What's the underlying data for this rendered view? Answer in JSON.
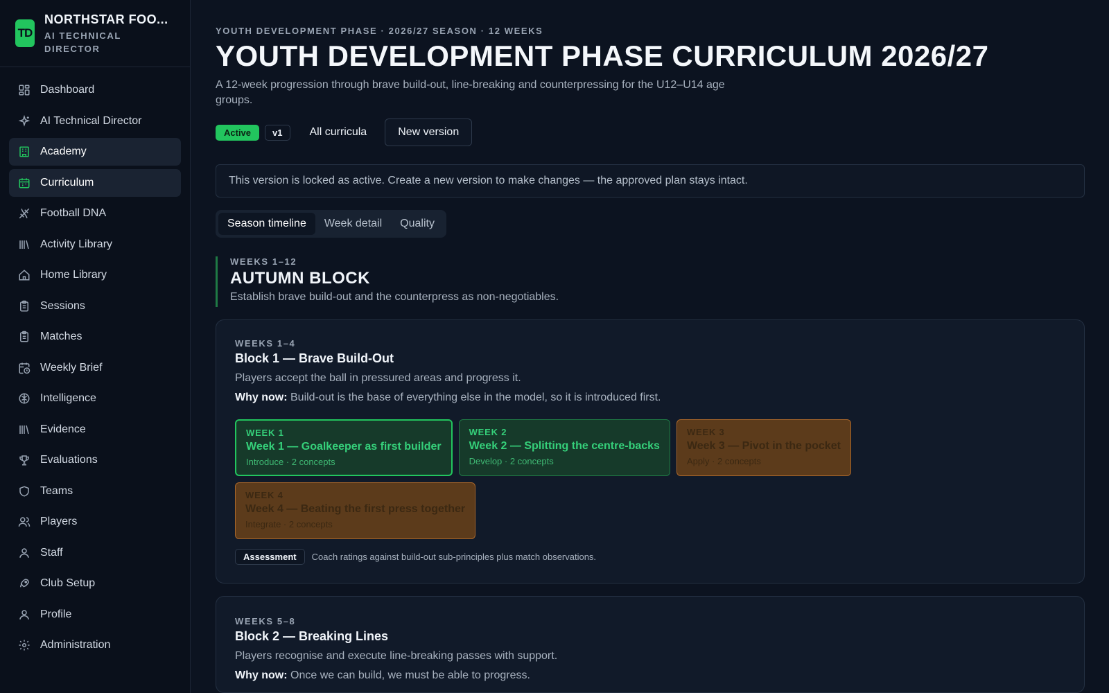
{
  "brand": {
    "logo_text": "TD",
    "name": "NORTHSTAR FOO...",
    "subtitle": "AI TECHNICAL DIRECTOR",
    "accent_color": "#22c55e"
  },
  "sidebar": {
    "items": [
      {
        "label": "Dashboard",
        "icon": "dashboard-icon"
      },
      {
        "label": "AI Technical Director",
        "icon": "sparkles-icon"
      },
      {
        "label": "Academy",
        "icon": "building-icon"
      },
      {
        "label": "Curriculum",
        "icon": "calendar-icon"
      },
      {
        "label": "Football DNA",
        "icon": "dna-icon"
      },
      {
        "label": "Activity Library",
        "icon": "library-icon"
      },
      {
        "label": "Home Library",
        "icon": "home-icon"
      },
      {
        "label": "Sessions",
        "icon": "clipboard-icon"
      },
      {
        "label": "Matches",
        "icon": "clipboard-icon"
      },
      {
        "label": "Weekly Brief",
        "icon": "calendar-clock-icon"
      },
      {
        "label": "Intelligence",
        "icon": "brain-icon"
      },
      {
        "label": "Evidence",
        "icon": "library-icon"
      },
      {
        "label": "Evaluations",
        "icon": "trophy-icon"
      },
      {
        "label": "Teams",
        "icon": "shield-icon"
      },
      {
        "label": "Players",
        "icon": "users-icon"
      },
      {
        "label": "Staff",
        "icon": "user-icon"
      },
      {
        "label": "Club Setup",
        "icon": "rocket-icon"
      },
      {
        "label": "Profile",
        "icon": "user-icon"
      },
      {
        "label": "Administration",
        "icon": "gear-icon"
      }
    ],
    "active_items": [
      "Academy",
      "Curriculum"
    ]
  },
  "header": {
    "eyebrow": "YOUTH DEVELOPMENT PHASE · 2026/27 SEASON · 12 WEEKS",
    "title": "YOUTH DEVELOPMENT PHASE CURRICULUM 2026/27",
    "subtitle": "A 12-week progression through brave build-out, line-breaking and counterpressing for the U12–U14 age groups."
  },
  "actions": {
    "status_badge": "Active",
    "version_badge": "v1",
    "all_curricula": "All curricula",
    "new_version": "New version"
  },
  "notice": "This version is locked as active. Create a new version to make changes — the approved plan stays intact.",
  "tabs": [
    {
      "label": "Season timeline",
      "active": true
    },
    {
      "label": "Week detail",
      "active": false
    },
    {
      "label": "Quality",
      "active": false
    }
  ],
  "season": {
    "eyebrow": "WEEKS 1–12",
    "title": "AUTUMN BLOCK",
    "description": "Establish brave build-out and the counterpress as non-negotiables."
  },
  "blocks": [
    {
      "eyebrow": "WEEKS 1–4",
      "title": "Block 1 — Brave Build-Out",
      "description": "Players accept the ball in pressured areas and progress it.",
      "why_label": "Why now:",
      "why_text": "Build-out is the base of everything else in the model, so it is introduced first.",
      "weeks": [
        {
          "eyebrow": "WEEK 1",
          "title": "Week 1 — Goalkeeper as first builder",
          "meta": "Introduce · 2 concepts",
          "color": "#22c55e"
        },
        {
          "eyebrow": "WEEK 2",
          "title": "Week 2 — Splitting the centre-backs",
          "meta": "Develop · 2 concepts",
          "color": "#22c55e"
        },
        {
          "eyebrow": "WEEK 3",
          "title": "Week 3 — Pivot in the pocket",
          "meta": "Apply · 2 concepts",
          "color": "#a8662a"
        },
        {
          "eyebrow": "WEEK 4",
          "title": "Week 4 — Beating the first press together",
          "meta": "Integrate · 2 concepts",
          "color": "#a8662a"
        }
      ],
      "assessment_label": "Assessment",
      "assessment_text": "Coach ratings against build-out sub-principles plus match observations."
    },
    {
      "eyebrow": "WEEKS 5–8",
      "title": "Block 2 — Breaking Lines",
      "description": "Players recognise and execute line-breaking passes with support.",
      "why_label": "Why now:",
      "why_text": "Once we can build, we must be able to progress."
    }
  ]
}
